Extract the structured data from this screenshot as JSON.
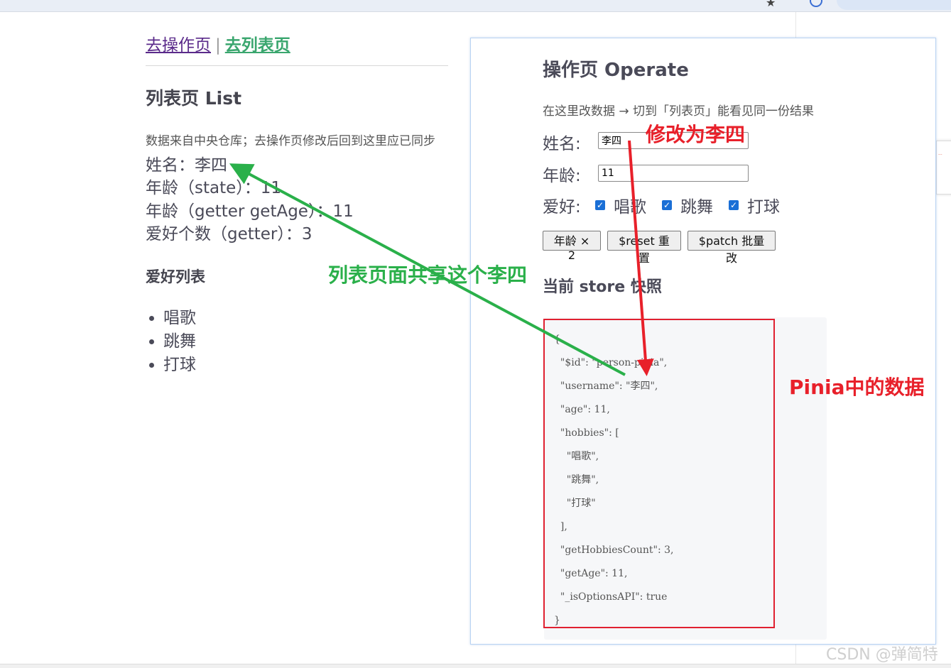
{
  "nav": {
    "operate_link": "去操作页",
    "separator": "|",
    "list_link": "去列表页"
  },
  "list_page": {
    "title": "列表页 List",
    "description": "数据来自中央仓库；去操作页修改后回到这里应已同步",
    "lines": [
      "姓名：李四",
      "年龄（state）：11",
      "年龄（getter getAge）：11",
      "爱好个数（getter）：3"
    ],
    "hobbies_title": "爱好列表",
    "hobbies": [
      "唱歌",
      "跳舞",
      "打球"
    ]
  },
  "operate_page": {
    "title": "操作页 Operate",
    "description": "在这里改数据 → 切到「列表页」能看见同一份结果",
    "name_label": "姓名:",
    "name_value": "李四",
    "age_label": "年龄:",
    "age_value": "11",
    "hobby_label": "爱好:",
    "hobby_options": [
      "唱歌",
      "跳舞",
      "打球"
    ],
    "buttons": {
      "double_age": "年龄 × 2",
      "reset": "$reset 重置",
      "patch": "$patch 批量改"
    },
    "snapshot_title": "当前 store 快照",
    "snapshot_json": "{\n  \"$id\": \"person-pinia\",\n  \"username\": \"李四\",\n  \"age\": 11,\n  \"hobbies\": [\n    \"唱歌\",\n    \"跳舞\",\n    \"打球\"\n  ],\n  \"getHobbiesCount\": 3,\n  \"getAge\": 11,\n  \"_isOptionsAPI\": true\n}"
  },
  "annotations": {
    "modify_label": "修改为李四",
    "shared_label": "列表页面共享这个李四",
    "pinia_label": "Pinia中的数据"
  },
  "watermark": "CSDN @弹简特",
  "colors": {
    "annotation_red": "#e8202a",
    "annotation_green": "#2ab04a",
    "checkbox_blue": "#1a6fd6"
  }
}
